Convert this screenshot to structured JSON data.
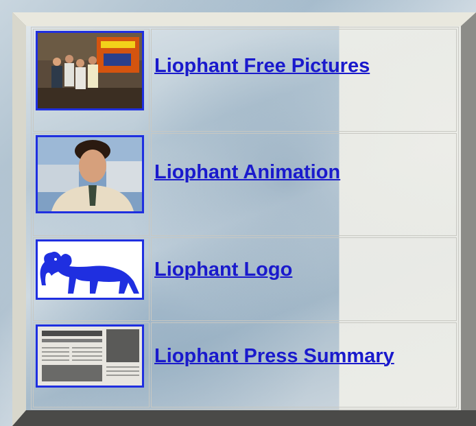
{
  "items": [
    {
      "label": "Liophant Free Pictures",
      "thumb": "people-group-photo"
    },
    {
      "label": "Liophant Animation",
      "thumb": "man-portrait-photo"
    },
    {
      "label": "Liophant Logo",
      "thumb": "liophant-logo-image"
    },
    {
      "label": "Liophant Press Summary",
      "thumb": "newspaper-clipping-image"
    }
  ],
  "colors": {
    "link": "#1a1acc",
    "thumb_border": "#1f2fe0",
    "logo": "#1f2fe0"
  }
}
